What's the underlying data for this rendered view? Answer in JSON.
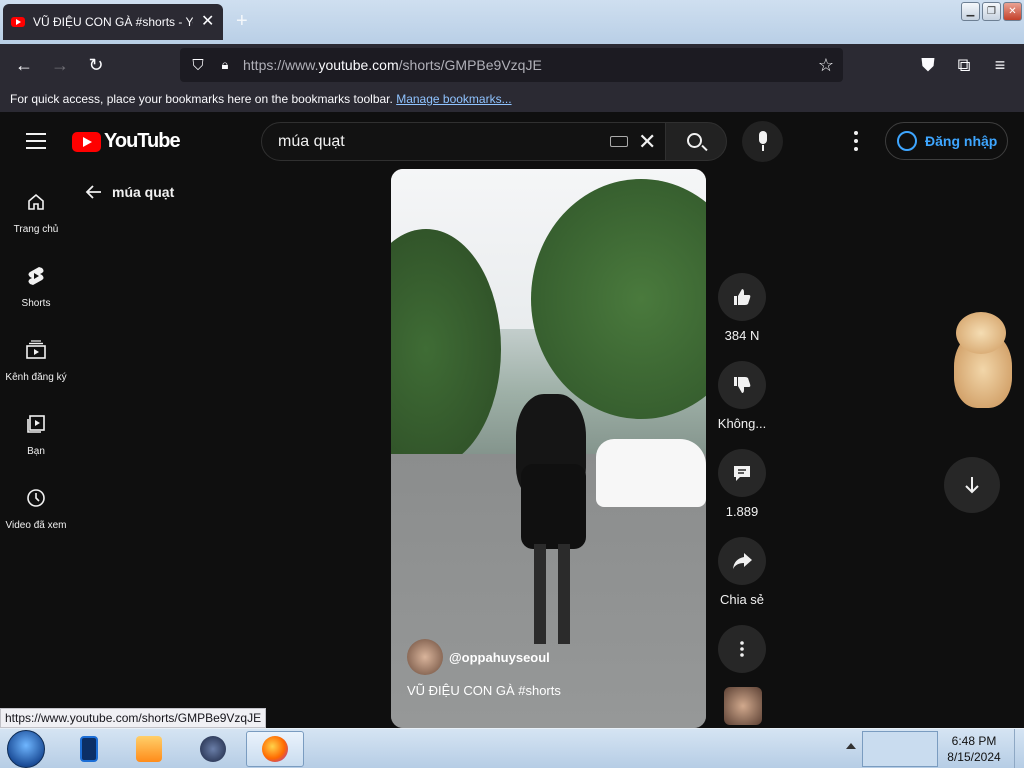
{
  "browser": {
    "tab_title": "VŨ ĐIỆU CON GÀ #shorts - You",
    "url_prefix": "https://www.",
    "url_domain": "youtube.com",
    "url_path": "/shorts/GMPBe9VzqJE",
    "bookmarks_text": "For quick access, place your bookmarks here on the bookmarks toolbar.",
    "bookmarks_link": "Manage bookmarks...",
    "status_url": "https://www.youtube.com/shorts/GMPBe9VzqJE"
  },
  "youtube": {
    "logo_text": "YouTube",
    "search_value": "múa quạt",
    "signin_label": "Đăng nhập",
    "back_label": "múa quạt",
    "guide": [
      {
        "label": "Trang chủ",
        "icon": "home-icon"
      },
      {
        "label": "Shorts",
        "icon": "shorts-icon"
      },
      {
        "label": "Kênh đăng ký",
        "icon": "subscriptions-icon"
      },
      {
        "label": "Bạn",
        "icon": "you-icon"
      },
      {
        "label": "Video đã xem",
        "icon": "history-icon"
      }
    ],
    "short": {
      "channel": "@oppahuyseoul",
      "title": "VŨ ĐIỆU CON GÀ #shorts"
    },
    "actions": {
      "like": "384 N",
      "dislike": "Không...",
      "comments": "1.889",
      "share": "Chia sẻ"
    }
  },
  "taskbar": {
    "time": "6:48 PM",
    "date": "8/15/2024"
  },
  "colors": {
    "yt_red": "#ff0000",
    "link_blue": "#3ea6ff",
    "background": "#0f0f0f"
  }
}
